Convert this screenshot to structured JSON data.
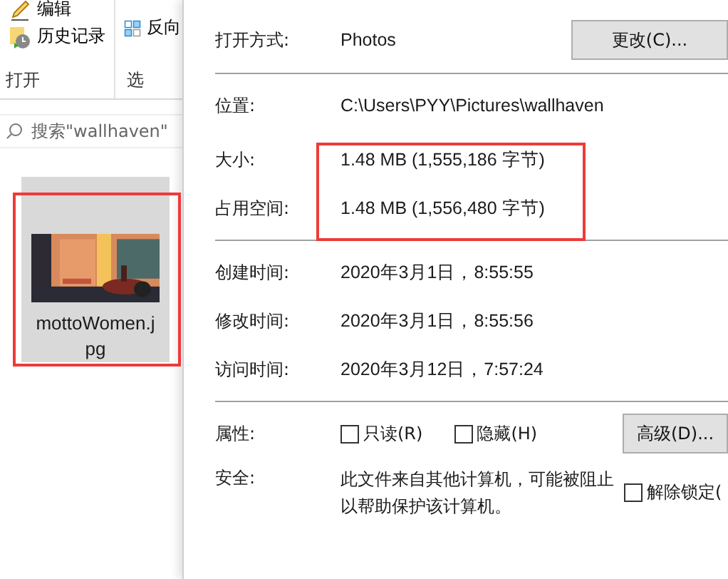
{
  "explorer": {
    "ribbon": {
      "items": [
        {
          "label": "编辑",
          "kind": "edit"
        },
        {
          "label": "历史记录",
          "kind": "history"
        }
      ],
      "group_label": "打开",
      "select_items": [
        {
          "label": "反向",
          "kind": "invert"
        }
      ],
      "select_group_label": "选"
    },
    "search": {
      "placeholder": "搜索\"wallhaven\""
    },
    "files": [
      {
        "name": "mottoWomen.jpg",
        "selected": true,
        "kind": "picture"
      }
    ]
  },
  "properties": {
    "open_with": {
      "label": "打开方式:",
      "value": "Photos",
      "button": "更改(C)..."
    },
    "info": [
      {
        "label": "位置:",
        "value": "C:\\Users\\PYY\\Pictures\\wallhaven"
      }
    ],
    "sizes": [
      {
        "label": "大小:",
        "value": "1.48 MB (1,555,186 字节)"
      },
      {
        "label": "占用空间:",
        "value": "1.48 MB (1,556,480 字节)"
      }
    ],
    "times": [
      {
        "label": "创建时间:",
        "value": "2020年3月1日，8:55:55"
      },
      {
        "label": "修改时间:",
        "value": "2020年3月1日，8:55:56"
      },
      {
        "label": "访问时间:",
        "value": "2020年3月12日，7:57:24"
      }
    ],
    "attributes": {
      "label": "属性:",
      "options": [
        {
          "label": "只读(R)",
          "checked": false
        },
        {
          "label": "隐藏(H)",
          "checked": false
        }
      ],
      "button": "高级(D)..."
    },
    "security": {
      "label": "安全:",
      "text": "此文件来自其他计算机，可能被阻止以帮助保护该计算机。",
      "unblock": {
        "label": "解除锁定(",
        "checked": false
      }
    }
  }
}
